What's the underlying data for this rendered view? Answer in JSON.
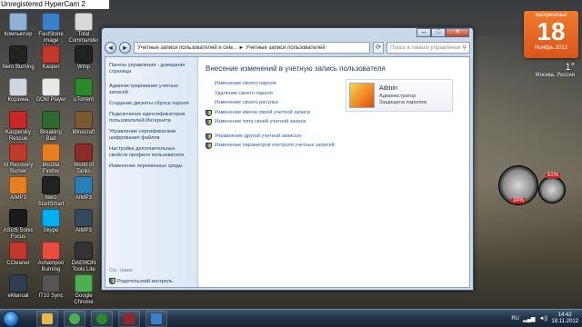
{
  "watermark": "Unregistered HyperCam 2",
  "desktop_icons": [
    {
      "label": "Компьютер",
      "color": "#8fb1d8"
    },
    {
      "label": "FastStone Image Viewer",
      "color": "#3c7fc9"
    },
    {
      "label": "Total Commander",
      "color": "#d9d9d9"
    },
    {
      "label": "Nero Burning",
      "color": "#222"
    },
    {
      "label": "Kasper",
      "color": "#c0392b"
    },
    {
      "label": "Wmp",
      "color": "#222"
    },
    {
      "label": "Корзина",
      "color": "#cfd6df"
    },
    {
      "label": "GOM Player",
      "color": "#e9e9e9"
    },
    {
      "label": "uTorrent",
      "color": "#2a8a2a"
    },
    {
      "label": "Kaspersky Rescue",
      "color": "#c62828"
    },
    {
      "label": "Breaking Bad",
      "color": "#2e6a2e"
    },
    {
      "label": "Minecraft",
      "color": "#7b5a32"
    },
    {
      "label": "AI Recovery Burner",
      "color": "#c0392b"
    },
    {
      "label": "Mozilla Firefox",
      "color": "#e67e22"
    },
    {
      "label": "World of Tanks",
      "color": "#8d2b2b"
    },
    {
      "label": "AIMP3",
      "color": "#e67e22"
    },
    {
      "label": "Nero StartSmart",
      "color": "#222"
    },
    {
      "label": "AIMP3",
      "color": "#2980b9"
    },
    {
      "label": "ASUS Sonic Focus",
      "color": "#1a1a1a"
    },
    {
      "label": "Skype",
      "color": "#00aff0"
    },
    {
      "label": "AIMP3",
      "color": "#34495e"
    },
    {
      "label": "CCleaner",
      "color": "#c0392b"
    },
    {
      "label": "Ashampoo Burning",
      "color": "#e74c3c"
    },
    {
      "label": "DAEMON Tools Lite",
      "color": "#333"
    },
    {
      "label": "eManual",
      "color": "#2c3e50"
    },
    {
      "label": "IT10 Sync",
      "color": "#555"
    },
    {
      "label": "Google Chrome",
      "color": "#4caf50"
    }
  ],
  "gadgets": {
    "calendar": {
      "dow": "воскресенье",
      "day": "18",
      "month": "Ноябрь 2012"
    },
    "weather": {
      "temp": "1°",
      "location": "Москва, Россия"
    },
    "meter": {
      "cpu": "34%",
      "ram": "51%"
    }
  },
  "window": {
    "controls": {
      "minimize": "–",
      "maximize": "□",
      "close": "✕"
    },
    "address": {
      "back": "◄",
      "forward": "►",
      "path": "Учетные записи пользователей и сем... ► Учетные записи пользователей",
      "refresh": "⟳"
    },
    "search": {
      "placeholder": "Поиск в панели управления",
      "icon": "search-icon"
    },
    "left_pane": {
      "links": [
        "Панель управления - домашняя страница",
        "Администрирование учетных записей",
        "Создание дискеты сброса пароля",
        "Подключение идентификаторов пользователей Интернета",
        "Управление сертификатами шифрования файлов",
        "Настройка дополнительных свойств профиля пользователя",
        "Изменение переменных среды"
      ],
      "see_also": "См. также",
      "parental": "Родительский контроль"
    },
    "main": {
      "title": "Внесение изменений в учетную запись пользователя",
      "actions_group1": [
        {
          "label": "Изменение своего пароля",
          "shield": false
        },
        {
          "label": "Удаление своего пароля",
          "shield": false
        },
        {
          "label": "Изменение своего рисунка",
          "shield": false
        },
        {
          "label": "Изменение имени своей учетной записи",
          "shield": true
        },
        {
          "label": "Изменение типа своей учетной записи",
          "shield": true
        }
      ],
      "actions_group2": [
        {
          "label": "Управление другой учетной записью",
          "shield": true
        },
        {
          "label": "Изменение параметров контроля учетных записей",
          "shield": true
        }
      ],
      "user": {
        "name": "Admin",
        "role": "Администратор",
        "status": "Защищена паролем"
      }
    }
  },
  "taskbar": {
    "lang": "RU",
    "time": "14:42",
    "date": "18.11.2012"
  }
}
